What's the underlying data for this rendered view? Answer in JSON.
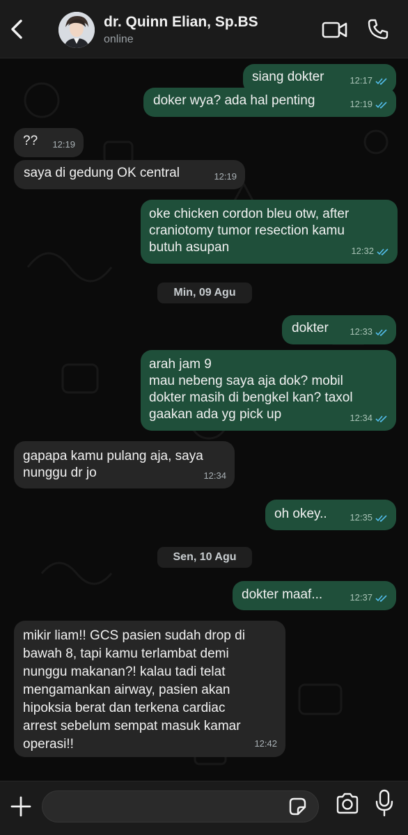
{
  "header": {
    "name": "dr. Quinn Elian, Sp.BS",
    "status": "online",
    "icons": [
      "chevron-left-icon",
      "video-call-icon",
      "phone-icon"
    ]
  },
  "messages": [
    {
      "dir": "out",
      "text": "siang dokter",
      "time": "12:17",
      "read": true
    },
    {
      "dir": "out",
      "text": "doker wya? ada hal penting",
      "time": "12:19",
      "read": true
    },
    {
      "dir": "in",
      "text": "??",
      "time": "12:19"
    },
    {
      "dir": "in",
      "text": "saya di gedung OK central",
      "time": "12:19"
    },
    {
      "dir": "out",
      "text": "oke chicken cordon bleu otw, after\ncraniotomy tumor resection kamu\nbutuh asupan",
      "time": "12:32",
      "read": true
    },
    {
      "dir": "out",
      "text": "dokter",
      "time": "12:33",
      "read": true
    },
    {
      "dir": "out",
      "text": "arah jam 9\nmau nebeng saya aja dok? mobil\ndokter masih di bengkel kan? taxol\ngaakan ada yg pick up",
      "time": "12:34",
      "read": true
    },
    {
      "dir": "in",
      "text": "gapapa kamu pulang aja, saya\nnunggu dr jo",
      "time": "12:34"
    },
    {
      "dir": "out",
      "text": "oh okey..",
      "time": "12:35",
      "read": true
    },
    {
      "dir": "out",
      "text": "dokter maaf...",
      "time": "12:37",
      "read": true
    },
    {
      "dir": "in",
      "text": "mikir liam!! GCS pasien sudah drop di\nbawah 8, tapi kamu terlambat demi\nnunggu makanan?! kalau tadi telat\nmengamankan airway, pasien akan\nhipoksia berat dan terkena cardiac\narrest sebelum sempat masuk kamar\noperasi!!",
      "time": "12:42"
    }
  ],
  "date_separators": [
    "Min, 09 Agu",
    "Sen, 10 Agu"
  ],
  "input": {
    "placeholder": "",
    "value": ""
  },
  "colors": {
    "outgoing": "#1f4f3a",
    "incoming": "#262626",
    "read_ticks": "#53bdeb",
    "background": "#0b0b0b"
  }
}
